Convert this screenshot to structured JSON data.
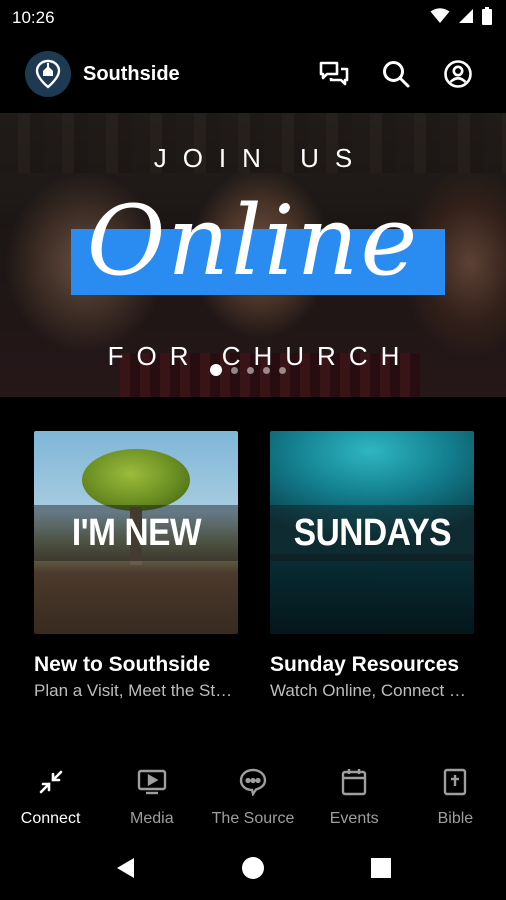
{
  "status_bar": {
    "time": "10:26",
    "icons": [
      "wifi-icon",
      "signal-icon",
      "battery-icon"
    ]
  },
  "app_bar": {
    "title": "Southside",
    "logo_icon": "church-location-pin-logo",
    "actions": [
      "chat-icon",
      "search-icon",
      "account-icon"
    ]
  },
  "hero": {
    "line1": "JOIN US",
    "script": "Online",
    "line2": "FOR CHURCH",
    "accent_color": "#2a8cf0",
    "slide_count": 5,
    "active_slide": 1
  },
  "cards": [
    {
      "image_text": "I'M NEW",
      "title": "New to Southside",
      "subtitle": "Plan a Visit, Meet the Staff & more"
    },
    {
      "image_text": "SUNDAYS",
      "title": "Sunday Resources",
      "subtitle": "Watch Online, Connect Card & more"
    }
  ],
  "bottom_nav": {
    "items": [
      {
        "label": "Connect",
        "icon": "connect-arrows-icon",
        "active": true
      },
      {
        "label": "Media",
        "icon": "media-play-icon",
        "active": false
      },
      {
        "label": "The Source",
        "icon": "chat-bubble-icon",
        "active": false
      },
      {
        "label": "Events",
        "icon": "calendar-icon",
        "active": false
      },
      {
        "label": "Bible",
        "icon": "bible-icon",
        "active": false
      }
    ]
  },
  "system_nav": [
    "back-icon",
    "home-icon",
    "recents-icon"
  ]
}
